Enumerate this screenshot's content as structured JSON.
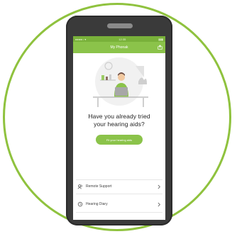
{
  "statusbar": {
    "left": "●●●●○ ▾",
    "center": "12:35",
    "right": "▮▮▮"
  },
  "topbar": {
    "title": "My Phonak",
    "share_icon": "share-icon"
  },
  "illustration": {
    "name": "person-at-laptop-illustration"
  },
  "main": {
    "question_line1": "Have you already tried",
    "question_line2": "your hearing aids?",
    "cta_label": "Fit your hearing aids"
  },
  "menu": {
    "items": [
      {
        "label": "Remote Support",
        "icon": "remote-support-icon"
      },
      {
        "label": "Hearing Diary",
        "icon": "hearing-diary-icon"
      }
    ]
  },
  "colors": {
    "accent": "#8bc34a",
    "ring": "#8fc23e",
    "phone": "#3a3a3a"
  }
}
